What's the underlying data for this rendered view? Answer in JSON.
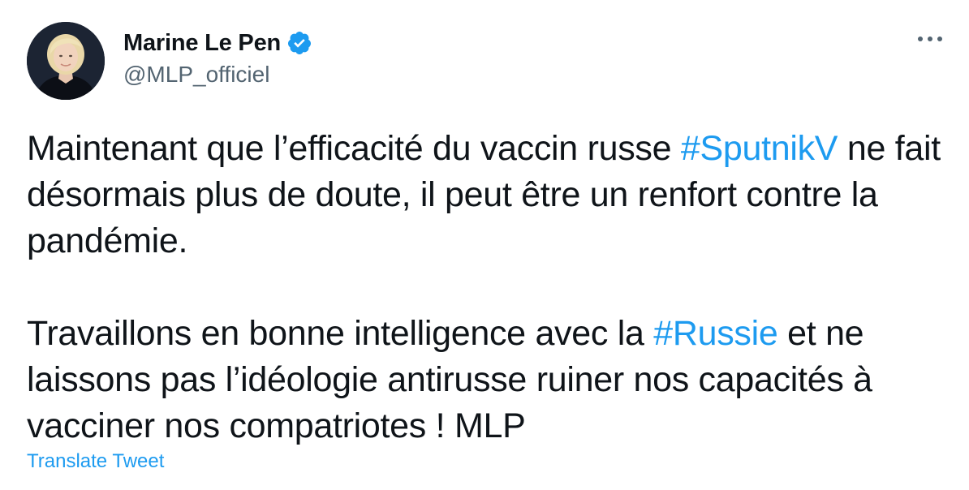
{
  "author": {
    "display_name": "Marine Le Pen",
    "handle": "@MLP_officiel",
    "verified": true,
    "avatar_icon": "profile-photo"
  },
  "tweet": {
    "paragraph1": {
      "text_before": "Maintenant que l’efficacité du vaccin russe ",
      "hashtag": "#SputnikV",
      "text_after": " ne fait désormais plus de doute, il peut être un renfort contre la pandémie."
    },
    "paragraph2": {
      "text_before": "Travaillons en bonne intelligence avec la ",
      "hashtag": "#Russie",
      "text_after": " et ne laissons pas l’idéologie antirusse ruiner nos capacités à vacciner nos compatriotes ! MLP"
    }
  },
  "actions": {
    "translate_label": "Translate Tweet",
    "more_icon": "more-horizontal-icon"
  },
  "colors": {
    "link": "#1d9bf0",
    "text": "#0f1419",
    "secondary": "#536471"
  }
}
